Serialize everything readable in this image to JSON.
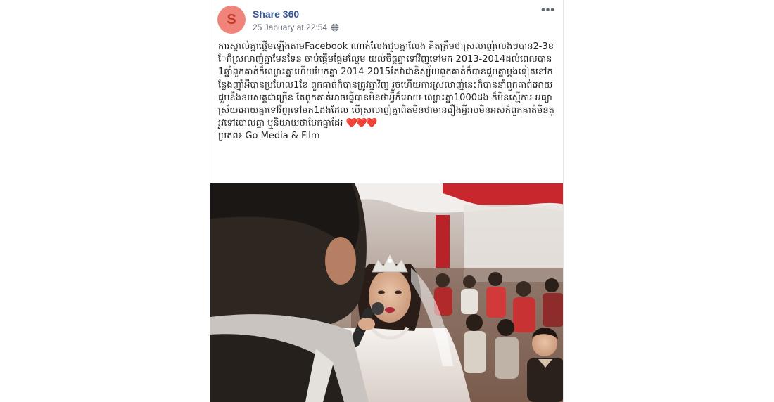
{
  "post": {
    "avatar_letter": "S",
    "page_name": "Share 360",
    "timestamp": "25 January at 22:54",
    "more_label": "•••",
    "privacy_icon": "globe-icon",
    "text": "ការស្គាល់គ្នាផ្តើមឡើងតាមFacebook ណាត់លែងជួបគ្នាលែង គិតត្រឹមថាស្រលាញ់លេងៗបាន2-3ខែក៏ស្រលាញ់គ្នាមែនទែន ចាប់ផ្តើមផ្លែមល្ហែម យល់ចិត្តគ្នាទៅវិញទៅមក 2013-2014ដល់ពេលបាន1ឆ្នាំពួកគាត់ក៏ឈ្លោះគ្នាហើយបែកគ្នា 2014-2015តែវាជានិស្ស័យពួកគាត់ក៏បានជួបគ្នាម្តងទៀតនៅកន្លែងញ៉ាំអីបានប្រហែល1ខែ ពួកគាត់ក៏បានត្រូវគ្នាវិញ រួចហើយការស្រលាញ់នេះក៏បាននាំពួកគាត់អោយជួបនឹងឧបសគ្គជាច្រើន តែពួកគាត់អាចធ្វើបានមិនថាអ្វីក៏អោយ ឈ្លោះគ្នា1000ដង ក៏មិនស្មើការ អធ្យាស្រ័យអោយគ្នាទៅវិញទៅមក1ដងដែល បើស្រលាញ់គ្នាពិតមិនថាមានរឿងអ្វីរាបមិនអស់ក៏ពួកគាត់មិនត្រូវទៅបោលគ្នា ឬនិយាយថាបែកគ្នាដែរ",
    "hearts": "❤️❤️❤️",
    "credit": "ប្រភព៖ Go Media & Film"
  },
  "photo": {
    "subject": "bride singing into microphone at wedding"
  },
  "colors": {
    "link": "#385898",
    "meta": "#616770",
    "text": "#1c1e21",
    "avatar_bg": "#f0847b"
  }
}
